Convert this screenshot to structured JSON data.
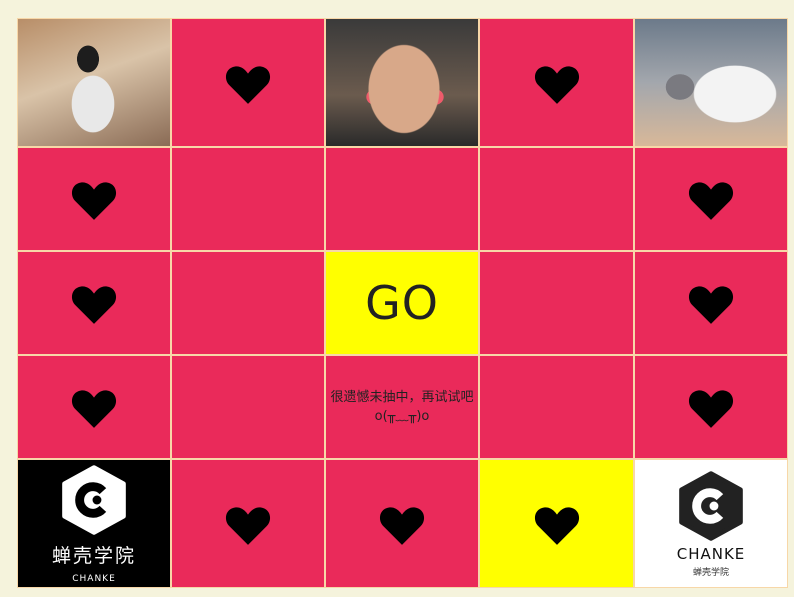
{
  "game": {
    "go_label": "GO",
    "result_message": "很遗憾未抽中，再试试吧o(╥﹏╥)o"
  },
  "logos": {
    "black": {
      "cn": "蝉壳学院",
      "en": "CHANKE"
    },
    "white": {
      "en": "CHANKE",
      "cn": "蝉壳学院"
    }
  },
  "colors": {
    "cell_red": "#ea2a5a",
    "highlight_yellow": "#ffff00",
    "page_background": "#f5f3dc"
  },
  "icons": {
    "heart": "heart-icon",
    "logo": "chanke-logo-icon"
  }
}
